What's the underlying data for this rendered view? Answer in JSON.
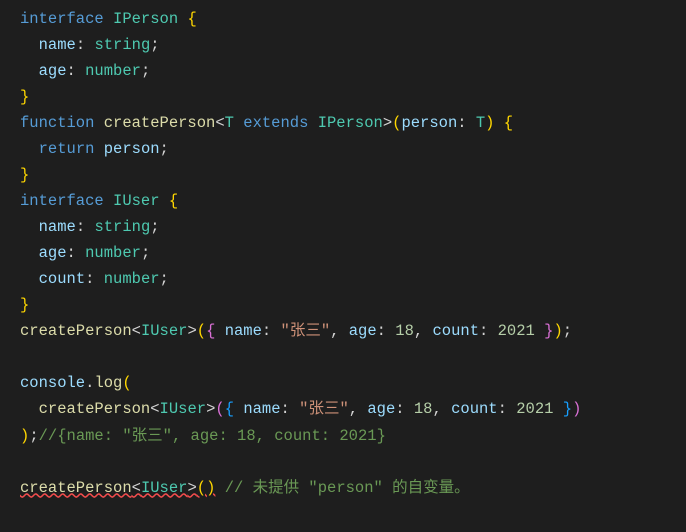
{
  "tokens": [
    [
      {
        "t": "interface ",
        "c": "kw"
      },
      {
        "t": "IPerson ",
        "c": "type"
      },
      {
        "t": "{",
        "c": "brace"
      }
    ],
    [
      {
        "t": "  ",
        "c": "op"
      },
      {
        "t": "name",
        "c": "var"
      },
      {
        "t": ": ",
        "c": "op"
      },
      {
        "t": "string",
        "c": "type"
      },
      {
        "t": ";",
        "c": "op"
      }
    ],
    [
      {
        "t": "  ",
        "c": "op"
      },
      {
        "t": "age",
        "c": "var"
      },
      {
        "t": ": ",
        "c": "op"
      },
      {
        "t": "number",
        "c": "type"
      },
      {
        "t": ";",
        "c": "op"
      }
    ],
    [
      {
        "t": "}",
        "c": "brace"
      }
    ],
    [
      {
        "t": "function ",
        "c": "kw"
      },
      {
        "t": "createPerson",
        "c": "fn"
      },
      {
        "t": "<",
        "c": "op"
      },
      {
        "t": "T ",
        "c": "type"
      },
      {
        "t": "extends ",
        "c": "kw"
      },
      {
        "t": "IPerson",
        "c": "type"
      },
      {
        "t": ">",
        "c": "op"
      },
      {
        "t": "(",
        "c": "brace"
      },
      {
        "t": "person",
        "c": "var"
      },
      {
        "t": ": ",
        "c": "op"
      },
      {
        "t": "T",
        "c": "type"
      },
      {
        "t": ")",
        "c": "brace"
      },
      {
        "t": " ",
        "c": "op"
      },
      {
        "t": "{",
        "c": "brace"
      }
    ],
    [
      {
        "t": "  ",
        "c": "op"
      },
      {
        "t": "return ",
        "c": "kw"
      },
      {
        "t": "person",
        "c": "var"
      },
      {
        "t": ";",
        "c": "op"
      }
    ],
    [
      {
        "t": "}",
        "c": "brace"
      }
    ],
    [
      {
        "t": "interface ",
        "c": "kw"
      },
      {
        "t": "IUser ",
        "c": "type"
      },
      {
        "t": "{",
        "c": "brace"
      }
    ],
    [
      {
        "t": "  ",
        "c": "op"
      },
      {
        "t": "name",
        "c": "var"
      },
      {
        "t": ": ",
        "c": "op"
      },
      {
        "t": "string",
        "c": "type"
      },
      {
        "t": ";",
        "c": "op"
      }
    ],
    [
      {
        "t": "  ",
        "c": "op"
      },
      {
        "t": "age",
        "c": "var"
      },
      {
        "t": ": ",
        "c": "op"
      },
      {
        "t": "number",
        "c": "type"
      },
      {
        "t": ";",
        "c": "op"
      }
    ],
    [
      {
        "t": "  ",
        "c": "op"
      },
      {
        "t": "count",
        "c": "var"
      },
      {
        "t": ": ",
        "c": "op"
      },
      {
        "t": "number",
        "c": "type"
      },
      {
        "t": ";",
        "c": "op"
      }
    ],
    [
      {
        "t": "}",
        "c": "brace"
      }
    ],
    [
      {
        "t": "createPerson",
        "c": "fn"
      },
      {
        "t": "<",
        "c": "op"
      },
      {
        "t": "IUser",
        "c": "type"
      },
      {
        "t": ">",
        "c": "op"
      },
      {
        "t": "(",
        "c": "brace"
      },
      {
        "t": "{",
        "c": "brace2"
      },
      {
        "t": " ",
        "c": "op"
      },
      {
        "t": "name",
        "c": "var"
      },
      {
        "t": ": ",
        "c": "op"
      },
      {
        "t": "\"张三\"",
        "c": "str"
      },
      {
        "t": ", ",
        "c": "op"
      },
      {
        "t": "age",
        "c": "var"
      },
      {
        "t": ": ",
        "c": "op"
      },
      {
        "t": "18",
        "c": "num"
      },
      {
        "t": ", ",
        "c": "op"
      },
      {
        "t": "count",
        "c": "var"
      },
      {
        "t": ": ",
        "c": "op"
      },
      {
        "t": "2021",
        "c": "num"
      },
      {
        "t": " ",
        "c": "op"
      },
      {
        "t": "}",
        "c": "brace2"
      },
      {
        "t": ")",
        "c": "brace"
      },
      {
        "t": ";",
        "c": "op"
      }
    ],
    [
      {
        "t": " ",
        "c": "op"
      }
    ],
    [
      {
        "t": "console",
        "c": "var"
      },
      {
        "t": ".",
        "c": "op"
      },
      {
        "t": "log",
        "c": "fn"
      },
      {
        "t": "(",
        "c": "brace"
      }
    ],
    [
      {
        "t": "  ",
        "c": "op"
      },
      {
        "t": "createPerson",
        "c": "fn"
      },
      {
        "t": "<",
        "c": "op"
      },
      {
        "t": "IUser",
        "c": "type"
      },
      {
        "t": ">",
        "c": "op"
      },
      {
        "t": "(",
        "c": "brace2"
      },
      {
        "t": "{",
        "c": "brace3"
      },
      {
        "t": " ",
        "c": "op"
      },
      {
        "t": "name",
        "c": "var"
      },
      {
        "t": ": ",
        "c": "op"
      },
      {
        "t": "\"张三\"",
        "c": "str"
      },
      {
        "t": ", ",
        "c": "op"
      },
      {
        "t": "age",
        "c": "var"
      },
      {
        "t": ": ",
        "c": "op"
      },
      {
        "t": "18",
        "c": "num"
      },
      {
        "t": ", ",
        "c": "op"
      },
      {
        "t": "count",
        "c": "var"
      },
      {
        "t": ": ",
        "c": "op"
      },
      {
        "t": "2021",
        "c": "num"
      },
      {
        "t": " ",
        "c": "op"
      },
      {
        "t": "}",
        "c": "brace3"
      },
      {
        "t": ")",
        "c": "brace2"
      }
    ],
    [
      {
        "t": ")",
        "c": "brace"
      },
      {
        "t": ";",
        "c": "op"
      },
      {
        "t": "//{name: \"张三\", age: 18, count: 2021}",
        "c": "com"
      }
    ],
    [
      {
        "t": " ",
        "c": "op"
      }
    ],
    [
      {
        "t": "createPerson<IUser>()",
        "c": "fn",
        "err": true
      },
      {
        "t": " ",
        "c": "op"
      },
      {
        "t": "// 未提供 \"person\" 的自变量。",
        "c": "com"
      }
    ]
  ]
}
